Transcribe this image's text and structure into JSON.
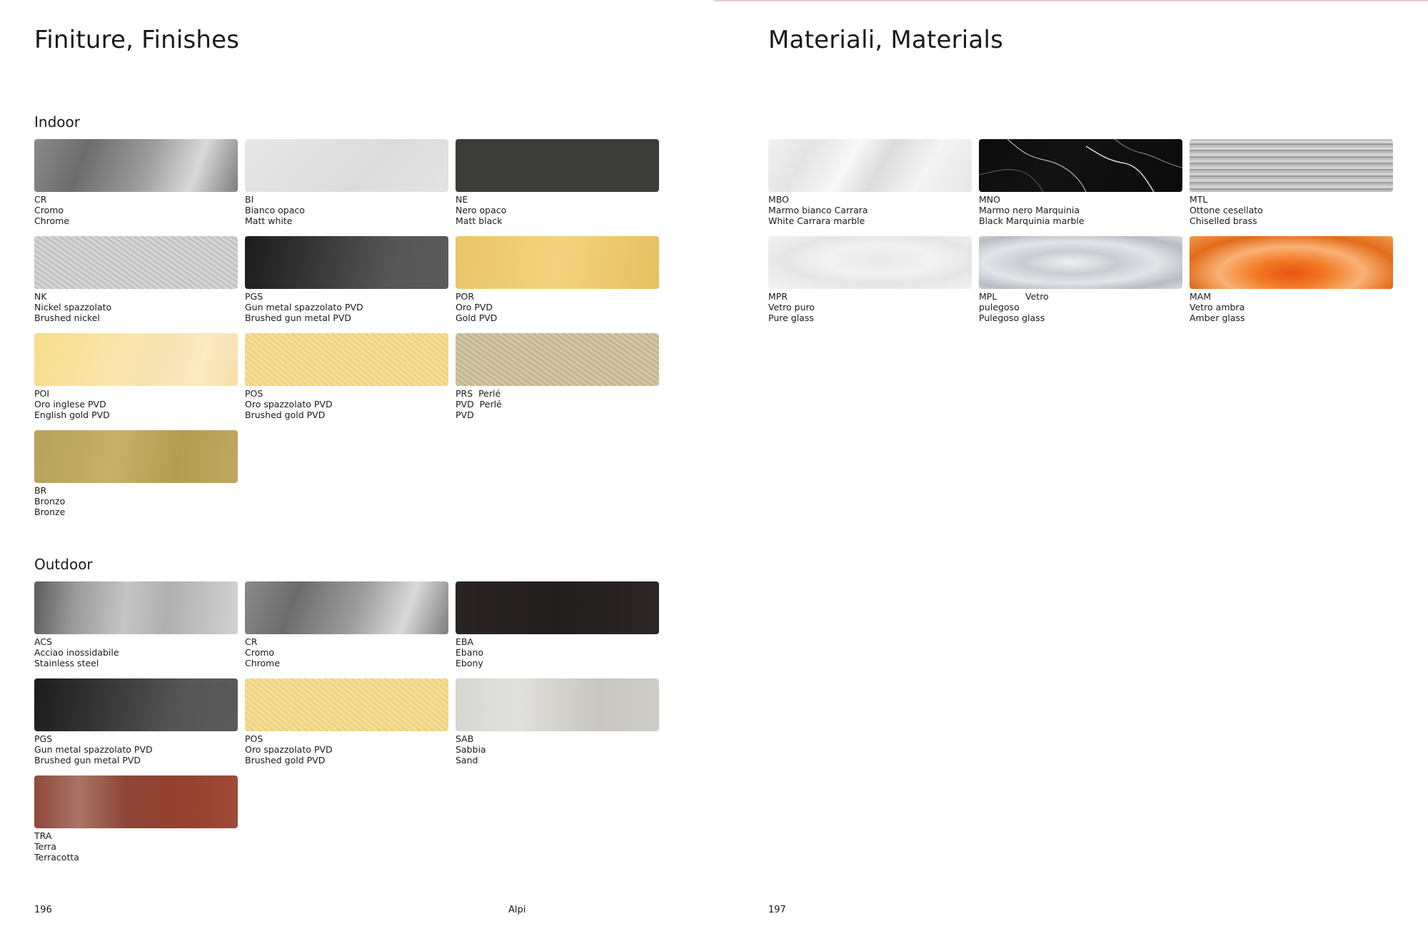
{
  "left_page": {
    "title": "Finiture, Finishes",
    "indoor": {
      "heading": "Indoor",
      "items": [
        {
          "code": "CR",
          "line2": "Cromo",
          "line3": "Chrome"
        },
        {
          "code": "BI",
          "line2": "Bianco opaco",
          "line3": "Matt white"
        },
        {
          "code": "NE",
          "line2": "Nero opaco",
          "line3": "Matt black"
        },
        {
          "code": "NK",
          "line2": "Nickel spazzolato",
          "line3": "Brushed nickel"
        },
        {
          "code": "PGS",
          "line2": "Gun metal spazzolato PVD",
          "line3": "Brushed gun metal PVD"
        },
        {
          "code": "POR",
          "line2": "Oro PVD",
          "line3": "Gold PVD"
        },
        {
          "code": "POI",
          "line2": "Oro inglese PVD",
          "line3": "English gold PVD"
        },
        {
          "code": "POS",
          "line2": "Oro spazzolato PVD",
          "line3": "Brushed gold PVD"
        },
        {
          "code": "PRS  Perlé",
          "line2": "PVD  Perlé",
          "line3": "PVD"
        },
        {
          "code": "BR",
          "line2": "Bronzo",
          "line3": "Bronze"
        }
      ]
    },
    "outdoor": {
      "heading": "Outdoor",
      "items": [
        {
          "code": "ACS",
          "line2": "Acciao inossidabile",
          "line3": "Stainless steel"
        },
        {
          "code": "CR",
          "line2": "Cromo",
          "line3": "Chrome"
        },
        {
          "code": "EBA",
          "line2": "Ebano",
          "line3": "Ebony"
        },
        {
          "code": "PGS",
          "line2": "Gun metal spazzolato PVD",
          "line3": "Brushed gun metal PVD"
        },
        {
          "code": "POS",
          "line2": "Oro spazzolato PVD",
          "line3": "Brushed gold PVD"
        },
        {
          "code": "SAB",
          "line2": "Sabbia",
          "line3": "Sand"
        },
        {
          "code": "TRA",
          "line2": "Terra",
          "line3": "Terracotta"
        }
      ]
    },
    "page_number": "196",
    "footer_center": "Alpi"
  },
  "right_page": {
    "title": "Materiali, Materials",
    "items": [
      {
        "code": "MBO",
        "line2": "Marmo bianco Carrara",
        "line3": "White Carrara marble"
      },
      {
        "code": "MNO",
        "line2": "Marmo nero Marquinia",
        "line3": "Black Marquinia marble"
      },
      {
        "code": "MTL",
        "line2": "Ottone cesellato",
        "line3": "Chiselled brass"
      },
      {
        "code": "MPR",
        "line2": "Vetro puro",
        "line3": "Pure glass"
      },
      {
        "code": "MPL          Vetro",
        "line2": "pulegoso",
        "line3": "Pulegoso glass"
      },
      {
        "code": "MAM",
        "line2": "Vetro ambra",
        "line3": "Amber glass"
      }
    ],
    "page_number": "197"
  }
}
